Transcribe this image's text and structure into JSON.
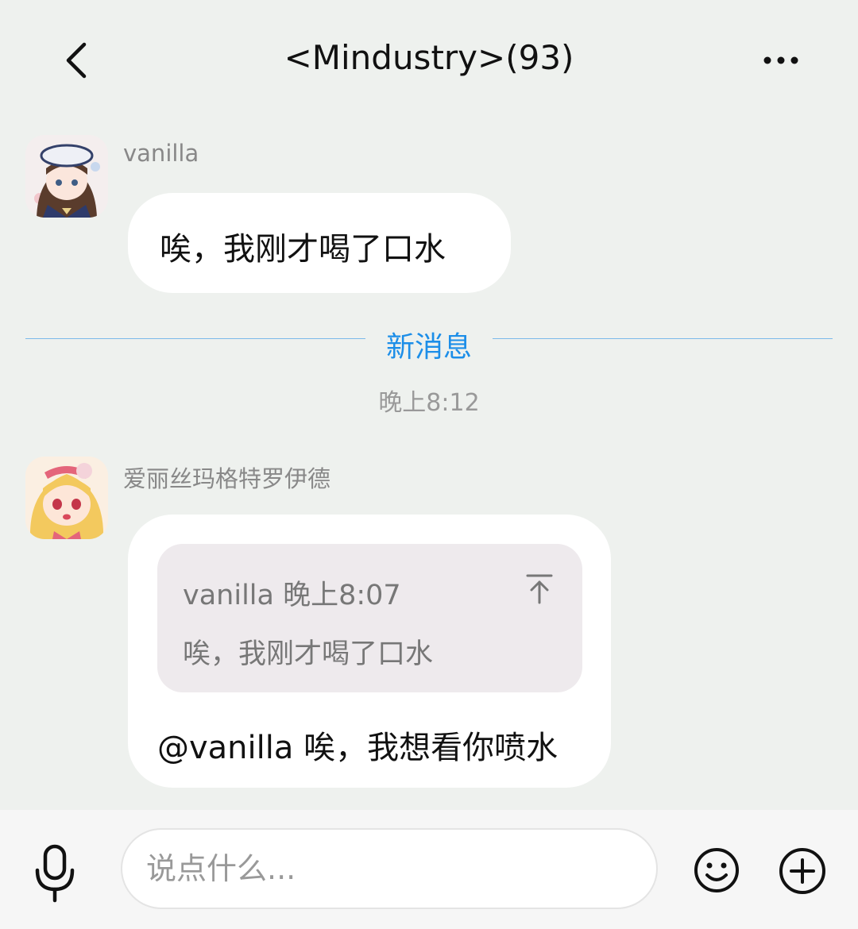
{
  "header": {
    "title": "<Mindustry>(93)",
    "back_icon": "chevron-left-icon",
    "more_icon": "more-dots-icon"
  },
  "messages": [
    {
      "sender": "vanilla",
      "avatar": "anime-girl-sailor-hat-avatar",
      "text": "唉，我刚才喝了口水"
    },
    {
      "sender": "爱丽丝玛格特罗伊德",
      "avatar": "anime-blonde-girl-avatar",
      "quote": {
        "meta": "vanilla 晚上8:07",
        "text": "唉，我刚才喝了口水",
        "jump_icon": "jump-to-top-arrow-icon"
      },
      "text": "@vanilla 唉，我想看你喷水"
    }
  ],
  "divider": {
    "label": "新消息"
  },
  "timestamp": "晚上8:12",
  "input_bar": {
    "placeholder": "说点什么...",
    "mic_icon": "microphone-icon",
    "emoji_icon": "smiley-icon",
    "plus_icon": "plus-circle-icon"
  },
  "colors": {
    "background": "#eef1ee",
    "accent": "#1c8ee8",
    "bubble": "#ffffff",
    "quote_bg": "#eeeaed"
  }
}
